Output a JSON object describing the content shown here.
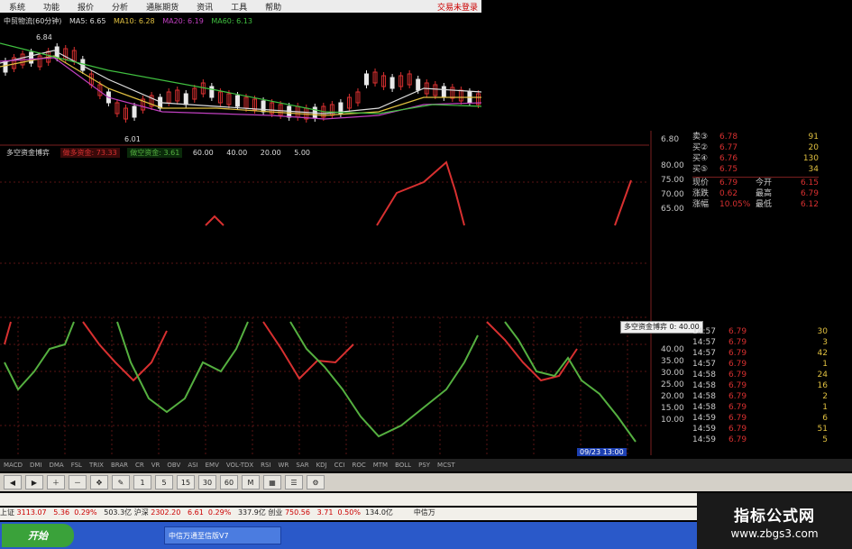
{
  "menu": {
    "items": [
      "系统",
      "功能",
      "报价",
      "分析",
      "通胀期货",
      "资讯",
      "工具",
      "帮助"
    ],
    "right": "交易未登录"
  },
  "ma_line": {
    "title": "中贸物流(60分钟)",
    "ma5": "MA5: 6.65",
    "ma10": "MA10: 6.28",
    "ma20": "MA20: 6.19",
    "ma60": "MA60: 6.13"
  },
  "price_labels": {
    "high": "6.84",
    "low": "6.01"
  },
  "indicator": {
    "name": "多空资金博弈",
    "red_label": "做多资金: 73.33",
    "green_label": "做空资金: 3.61",
    "levels": [
      "60.00",
      "40.00",
      "20.00",
      "5.00"
    ]
  },
  "right_panel": {
    "scale_top": [
      "6.80",
      "80.00",
      "75.00",
      "70.00",
      "65.00"
    ],
    "orders": [
      {
        "label": "卖③",
        "price": "6.78",
        "vol": "91"
      },
      {
        "label": "买②",
        "price": "6.77",
        "vol": "20"
      },
      {
        "label": "买④",
        "price": "6.76",
        "vol": "130"
      },
      {
        "label": "买⑤",
        "price": "6.75",
        "vol": "34"
      }
    ],
    "summary": [
      {
        "a": "现价",
        "b": "6.79",
        "c": "今开",
        "d": "6.15"
      },
      {
        "a": "涨跌",
        "b": "0.62",
        "c": "最高",
        "d": "6.79"
      },
      {
        "a": "涨幅",
        "b": "10.05%",
        "c": "最低",
        "d": "6.12"
      }
    ],
    "tooltip": "多空资金博弈 0: 40.00",
    "trades": [
      {
        "t": "14:57",
        "p": "6.79",
        "v": "30"
      },
      {
        "t": "14:57",
        "p": "6.79",
        "v": "3"
      },
      {
        "t": "14:57",
        "p": "6.79",
        "v": "42"
      },
      {
        "t": "14:57",
        "p": "6.79",
        "v": "1"
      },
      {
        "t": "14:58",
        "p": "6.79",
        "v": "24"
      },
      {
        "t": "14:58",
        "p": "6.79",
        "v": "16"
      },
      {
        "t": "14:58",
        "p": "6.79",
        "v": "2"
      },
      {
        "t": "14:58",
        "p": "6.79",
        "v": "1"
      },
      {
        "t": "14:59",
        "p": "6.79",
        "v": "6"
      },
      {
        "t": "14:59",
        "p": "6.79",
        "v": "51"
      },
      {
        "t": "14:59",
        "p": "6.79",
        "v": "5"
      }
    ],
    "scale_bottom": [
      "40.00",
      "35.00",
      "30.00",
      "25.00",
      "20.00",
      "15.00",
      "10.00"
    ]
  },
  "date_label": "09/23 13:00",
  "tabs": [
    "MACD",
    "DMI",
    "DMA",
    "FSL",
    "TRIX",
    "BRAR",
    "CR",
    "VR",
    "OBV",
    "ASI",
    "EMV",
    "VOL-TDX",
    "RSI",
    "WR",
    "SAR",
    "KDJ",
    "CCI",
    "ROC",
    "MTM",
    "BOLL",
    "PSY",
    "MCST"
  ],
  "toolbar_buttons": [
    "1",
    "5",
    "15",
    "30",
    "60",
    "M"
  ],
  "ticker": {
    "index_name": "上证",
    "index_value": "3113.07",
    "change": "5.36",
    "pct": "0.29%",
    "turnover1": "503.3亿",
    "name2": "沪深",
    "value2": "2302.20",
    "change2": "6.61",
    "pct2": "0.29%",
    "turnover2": "337.9亿",
    "name3": "创业",
    "value3": "750.56",
    "change3": "3.71",
    "pct3": "0.50%",
    "turnover3": "134.0亿",
    "right_tag": "中信万"
  },
  "taskbar": {
    "start": "开始",
    "item": "中信万通至信版V7"
  },
  "logo": {
    "title": "指标公式网",
    "url": "www.zbgs3.com"
  },
  "colors": {
    "red": "#d83030",
    "green": "#55b040",
    "grid": "#7a1f1f",
    "bg": "#000000"
  }
}
